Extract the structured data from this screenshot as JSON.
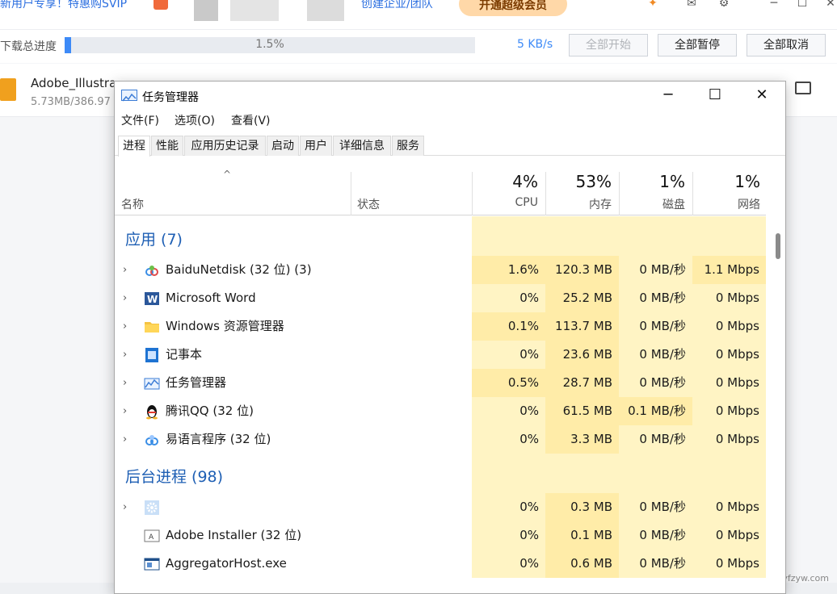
{
  "background_app": {
    "promo_text": "新用户专享！特惠购SVIP",
    "link_text": "创建企业/团队",
    "vip_button": "开通超级会员",
    "total_label": "下载总进度",
    "total_percent_text": "1.5%",
    "total_progress": 0.015,
    "speed": "5 KB/s",
    "btn_start_all": "全部开始",
    "btn_pause_all": "全部暂停",
    "btn_cancel_all": "全部取消",
    "file_name": "Adobe_Illustra",
    "file_size": "5.73MB/386.97",
    "watermark": "@云帆资源网 yfzyw.com"
  },
  "window": {
    "title": "任务管理器",
    "minimize": "─",
    "maximize": "☐",
    "close": "✕"
  },
  "menu": [
    "文件(F)",
    "选项(O)",
    "查看(V)"
  ],
  "tabs": [
    "进程",
    "性能",
    "应用历史记录",
    "启动",
    "用户",
    "详细信息",
    "服务"
  ],
  "columns": {
    "name": "名称",
    "status": "状态",
    "cpu_pct": "4%",
    "cpu": "CPU",
    "mem_pct": "53%",
    "mem": "内存",
    "disk_pct": "1%",
    "disk": "磁盘",
    "net_pct": "1%",
    "net": "网络"
  },
  "groups": {
    "apps_title": "应用 (7)",
    "bg_title": "后台进程 (98)"
  },
  "apps": [
    {
      "name": "BaiduNetdisk (32 位) (3)",
      "icon": "baidu-netdisk-icon",
      "cpu": "1.6%",
      "mem": "120.3 MB",
      "disk": "0 MB/秒",
      "net": "1.1 Mbps"
    },
    {
      "name": "Microsoft Word",
      "icon": "word-icon",
      "cpu": "0%",
      "mem": "25.2 MB",
      "disk": "0 MB/秒",
      "net": "0 Mbps"
    },
    {
      "name": "Windows 资源管理器",
      "icon": "folder-icon",
      "cpu": "0.1%",
      "mem": "113.7 MB",
      "disk": "0 MB/秒",
      "net": "0 Mbps"
    },
    {
      "name": "记事本",
      "icon": "notepad-icon",
      "cpu": "0%",
      "mem": "23.6 MB",
      "disk": "0 MB/秒",
      "net": "0 Mbps"
    },
    {
      "name": "任务管理器",
      "icon": "task-manager-icon",
      "cpu": "0.5%",
      "mem": "28.7 MB",
      "disk": "0 MB/秒",
      "net": "0 Mbps"
    },
    {
      "name": "腾讯QQ (32 位)",
      "icon": "qq-penguin-icon",
      "cpu": "0%",
      "mem": "61.5 MB",
      "disk": "0.1 MB/秒",
      "net": "0 Mbps"
    },
    {
      "name": "易语言程序 (32 位)",
      "icon": "program-icon",
      "cpu": "0%",
      "mem": "3.3 MB",
      "disk": "0 MB/秒",
      "net": "0 Mbps"
    }
  ],
  "background": [
    {
      "name": "",
      "icon": "gear-icon",
      "cpu": "0%",
      "mem": "0.3 MB",
      "disk": "0 MB/秒",
      "net": "0 Mbps"
    },
    {
      "name": "Adobe Installer (32 位)",
      "icon": "adobe-installer-icon",
      "cpu": "0%",
      "mem": "0.1 MB",
      "disk": "0 MB/秒",
      "net": "0 Mbps"
    },
    {
      "name": "AggregatorHost.exe",
      "icon": "exe-icon",
      "cpu": "0%",
      "mem": "0.6 MB",
      "disk": "0 MB/秒",
      "net": "0 Mbps"
    }
  ],
  "colors": {
    "heat_light": "#fff4c4",
    "heat_medium": "#ffeca8",
    "group_blue": "#1e5fb4"
  }
}
